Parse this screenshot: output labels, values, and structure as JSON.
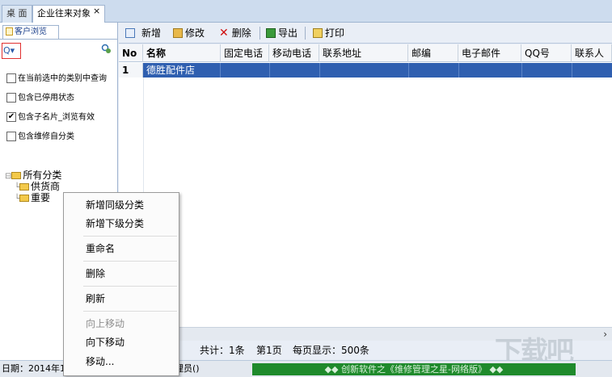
{
  "tabs": [
    {
      "label": "桌 面"
    },
    {
      "label": "企业往来对象",
      "close": "×"
    }
  ],
  "left_panel": {
    "tab_label": "客户浏览",
    "search_label": "Q▾",
    "checkboxes": [
      {
        "label": "在当前选中的类别中查询",
        "checked": false
      },
      {
        "label": "包含已停用状态",
        "checked": false
      },
      {
        "label": "包含子名片_浏览有效",
        "checked": true
      },
      {
        "label": "包含维修自分类",
        "checked": false
      }
    ],
    "tree": {
      "root": "所有分类",
      "children": [
        "供货商",
        "重要"
      ]
    }
  },
  "toolbar": {
    "add": "新增",
    "edit": "修改",
    "delete": "删除",
    "export": "导出",
    "print": "打印"
  },
  "table": {
    "columns": [
      "No",
      "名称",
      "固定电话",
      "移动电话",
      "联系地址",
      "邮编",
      "电子邮件",
      "QQ号",
      "联系人"
    ],
    "rows": [
      {
        "no": "1",
        "name": "德胜配件店"
      }
    ]
  },
  "pager": {
    "total": "共计：1条",
    "page": "第1页",
    "per_page": "每页显示：500条"
  },
  "status": {
    "date": "日期：2014年10",
    "user": "理员()",
    "banner": "◆◆ 创新软件之《维修管理之星-网络版》 ◆◆"
  },
  "context_menu": [
    {
      "label": "新增同级分类",
      "disabled": false
    },
    {
      "label": "新增下级分类",
      "disabled": false
    },
    {
      "label": "重命名",
      "disabled": false
    },
    {
      "label": "删除",
      "disabled": false
    },
    {
      "label": "刷新",
      "disabled": false
    },
    {
      "label": "向上移动",
      "disabled": true
    },
    {
      "label": "向下移动",
      "disabled": false
    },
    {
      "label": "移动...",
      "disabled": false
    }
  ],
  "colors": {
    "selection": "#2f5fb0",
    "banner": "#1f8a2c"
  }
}
